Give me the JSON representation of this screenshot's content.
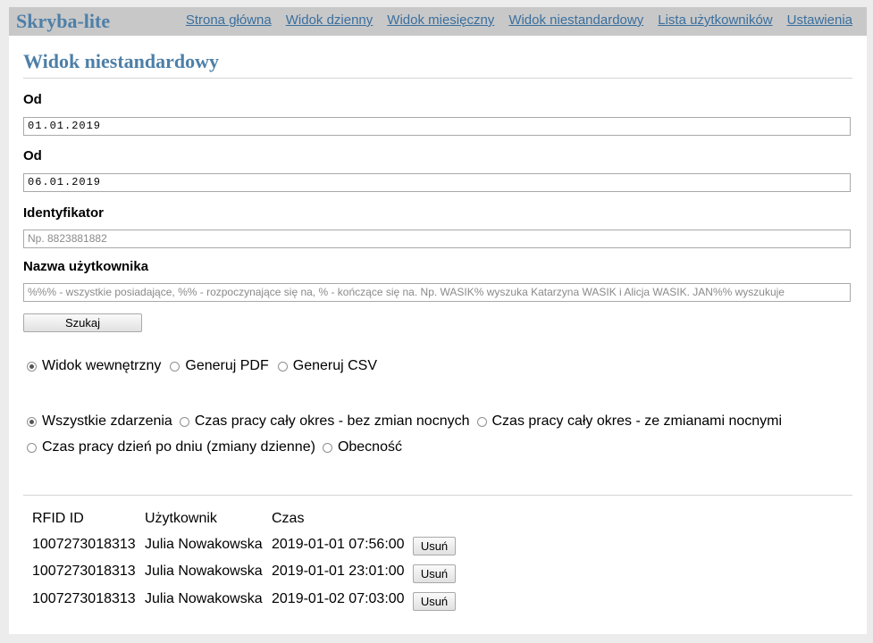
{
  "app": {
    "brand": "Skryba-lite"
  },
  "nav": {
    "items": [
      {
        "label": "Strona główna"
      },
      {
        "label": "Widok dzienny"
      },
      {
        "label": "Widok miesięczny"
      },
      {
        "label": "Widok niestandardowy"
      },
      {
        "label": "Lista użytkowników"
      },
      {
        "label": "Ustawienia"
      }
    ]
  },
  "page": {
    "title": "Widok niestandardowy"
  },
  "form": {
    "from_label": "Od",
    "from_value": "01.01.2019",
    "to_label": "Od",
    "to_value": "06.01.2019",
    "id_label": "Identyfikator",
    "id_placeholder": "Np. 8823881882",
    "user_label": "Nazwa użytkownika",
    "user_placeholder": "%%% - wszystkie posiadające, %% - rozpoczynające się na, % - kończące się na. Np. WASIK% wyszuka Katarzyna WASIK i Alicja WASIK. JAN%% wyszukuje",
    "search_label": "Szukaj"
  },
  "output_options": {
    "selected": "Widok wewnętrzny",
    "options": [
      "Widok wewnętrzny",
      "Generuj PDF",
      "Generuj CSV"
    ]
  },
  "report_options": {
    "selected": "Wszystkie zdarzenia",
    "options": [
      "Wszystkie zdarzenia",
      "Czas pracy cały okres - bez zmian nocnych",
      "Czas pracy cały okres - ze zmianami nocnymi",
      "Czas pracy dzień po dniu (zmiany dzienne)",
      "Obecność"
    ]
  },
  "table": {
    "headers": [
      "RFID ID",
      "Użytkownik",
      "Czas"
    ],
    "delete_label": "Usuń",
    "rows": [
      {
        "rfid": "1007273018313",
        "user": "Julia Nowakowska",
        "time": "2019-01-01 07:56:00"
      },
      {
        "rfid": "1007273018313",
        "user": "Julia Nowakowska",
        "time": "2019-01-01 23:01:00"
      },
      {
        "rfid": "1007273018313",
        "user": "Julia Nowakowska",
        "time": "2019-01-02 07:03:00"
      }
    ]
  }
}
